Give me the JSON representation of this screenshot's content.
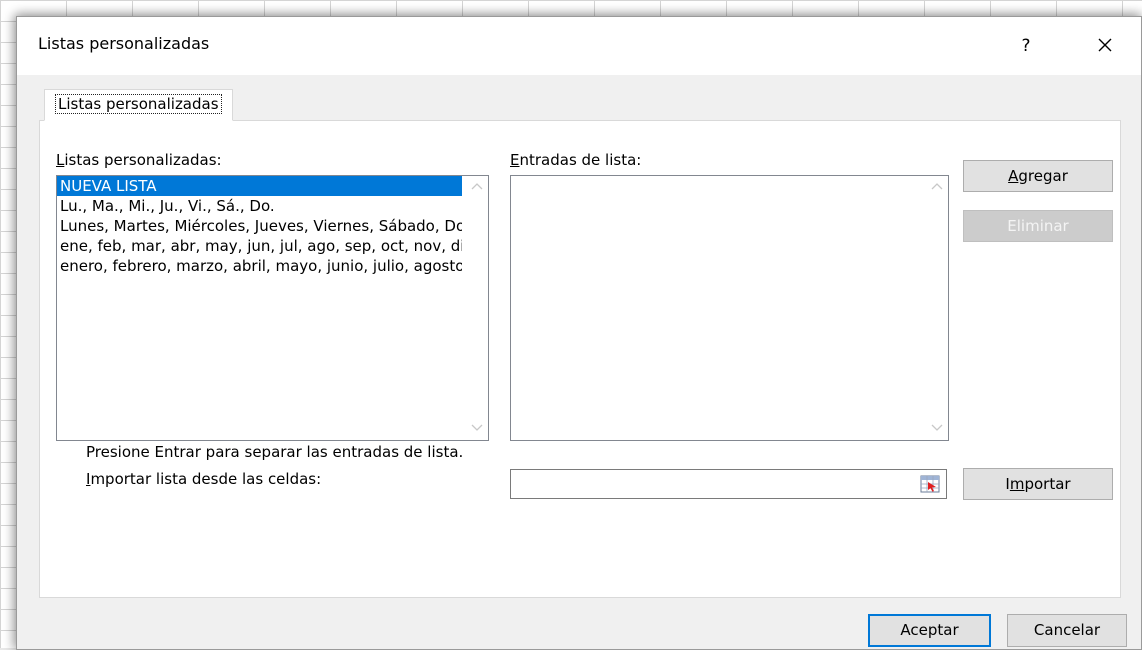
{
  "dialog": {
    "title": "Listas personalizadas",
    "help": "?",
    "close_icon": "close-icon"
  },
  "tab": {
    "label": "Listas personalizadas"
  },
  "custom_lists": {
    "label_first": "L",
    "label_rest": "istas personalizadas:",
    "items": [
      "NUEVA LISTA",
      "Lu., Ma., Mi., Ju., Vi., Sá., Do.",
      "Lunes, Martes, Miércoles, Jueves, Viernes, Sábado, Domingo",
      "ene, feb, mar, abr, may, jun, jul, ago, sep, oct, nov, dic",
      "enero, febrero, marzo, abril, mayo, junio, julio, agosto, septiembre, octubre, noviembre, diciembre"
    ],
    "selected_index": 0
  },
  "entries": {
    "label_first": "E",
    "label_rest": "ntradas de lista:",
    "value": ""
  },
  "buttons": {
    "add_first": "A",
    "add_rest": "gregar",
    "delete": "Eliminar",
    "import_first": "I",
    "import_mid": "m",
    "import_rest": "portar",
    "ok": "Aceptar",
    "cancel": "Cancelar"
  },
  "hint": "Presione Entrar para separar las entradas de lista.",
  "import": {
    "label_first": "I",
    "label_rest": "mportar lista desde las celdas:",
    "value": "",
    "range_icon": "range-select-icon"
  },
  "colors": {
    "selection": "#0078d7",
    "dialog_bg": "#f0f0f0",
    "default_button_border": "#0078d7"
  }
}
